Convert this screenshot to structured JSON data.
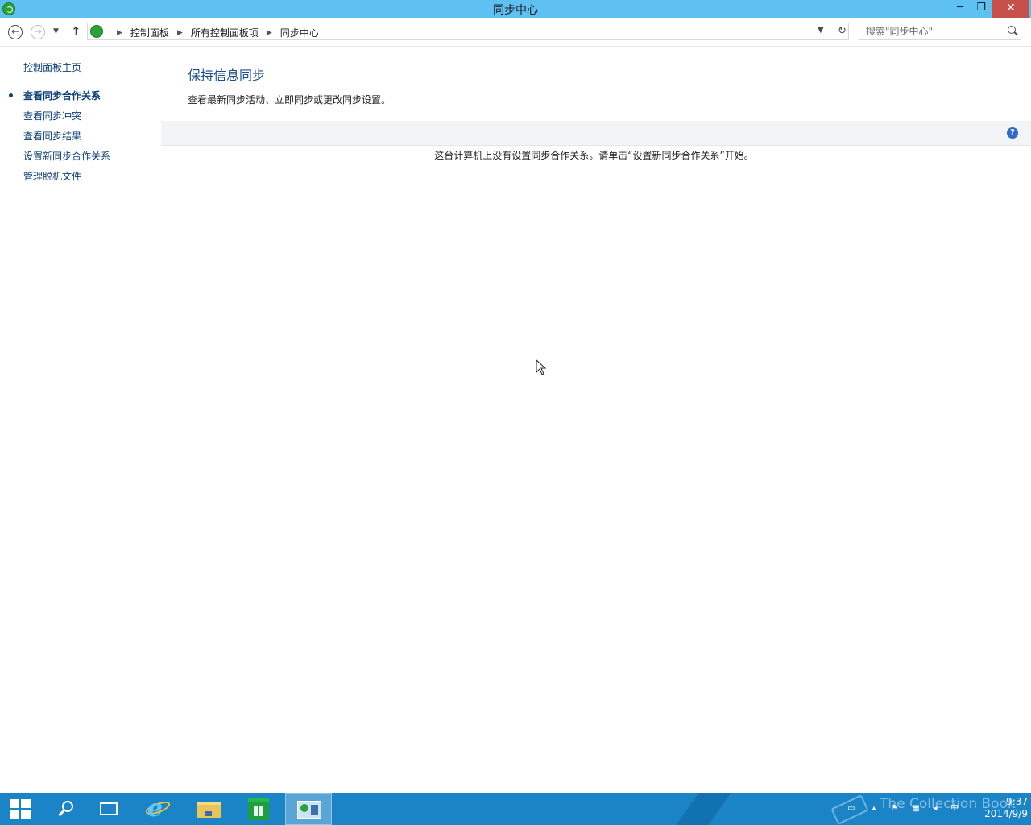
{
  "window": {
    "title": "同步中心",
    "controls": {
      "minimize": "─",
      "maximize": "❐",
      "close": "✕"
    }
  },
  "navbar": {
    "back_glyph": "←",
    "forward_glyph": "→",
    "recent_glyph": "▼",
    "up_glyph": "↑",
    "breadcrumb": [
      "控制面板",
      "所有控制面板项",
      "同步中心"
    ],
    "separator": "▶",
    "refresh_glyph": "↻",
    "search_placeholder": "搜索\"同步中心\""
  },
  "left_pane": {
    "home_link": "控制面板主页",
    "links": [
      {
        "label": "查看同步合作关系",
        "current": true
      },
      {
        "label": "查看同步冲突",
        "current": false
      },
      {
        "label": "查看同步结果",
        "current": false
      },
      {
        "label": "设置新同步合作关系",
        "current": false
      },
      {
        "label": "管理脱机文件",
        "current": false
      }
    ]
  },
  "main": {
    "heading": "保持信息同步",
    "description": "查看最新同步活动、立即同步或更改同步设置。",
    "help_glyph": "?",
    "empty_message": "这台计算机上没有设置同步合作关系。请单击“设置新同步合作关系”开始。"
  },
  "taskbar": {
    "apps": [
      {
        "name": "start",
        "icon": "windows-logo-icon"
      },
      {
        "name": "search",
        "icon": "search-icon"
      },
      {
        "name": "task-view",
        "icon": "task-view-icon"
      },
      {
        "name": "internet-explorer",
        "icon": "ie-icon"
      },
      {
        "name": "file-explorer",
        "icon": "folder-icon"
      },
      {
        "name": "store",
        "icon": "store-icon"
      },
      {
        "name": "control-panel",
        "icon": "control-panel-icon",
        "active": true
      }
    ],
    "watermark": "The Collection Book",
    "tray_ime": "中",
    "clock_time": "9:37",
    "clock_date": "2014/9/9"
  },
  "colors": {
    "titlebar": "#5fc0f2",
    "close_button": "#c7504a",
    "link": "#0b3f7a",
    "heading": "#1e4f8c",
    "taskbar": "#1a84c7"
  }
}
